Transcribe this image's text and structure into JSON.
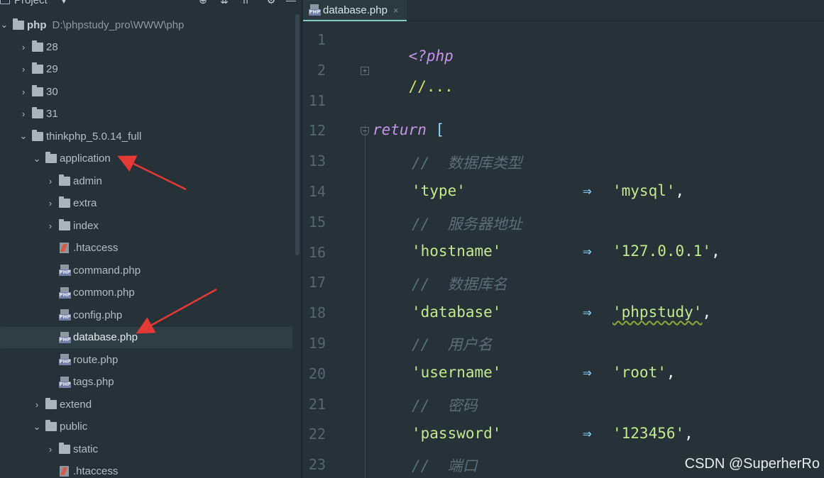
{
  "project_panel": {
    "title": "Project",
    "root": {
      "name": "php",
      "path": "D:\\phpstudy_pro\\WWW\\php"
    },
    "items": [
      {
        "label": "28",
        "type": "folder",
        "depth": 1,
        "expanded": false
      },
      {
        "label": "29",
        "type": "folder",
        "depth": 1,
        "expanded": false
      },
      {
        "label": "30",
        "type": "folder",
        "depth": 1,
        "expanded": false
      },
      {
        "label": "31",
        "type": "folder",
        "depth": 1,
        "expanded": false
      },
      {
        "label": "thinkphp_5.0.14_full",
        "type": "folder",
        "depth": 1,
        "expanded": true
      },
      {
        "label": "application",
        "type": "folder",
        "depth": 2,
        "expanded": true
      },
      {
        "label": "admin",
        "type": "folder",
        "depth": 3,
        "expanded": false
      },
      {
        "label": "extra",
        "type": "folder",
        "depth": 3,
        "expanded": false
      },
      {
        "label": "index",
        "type": "folder",
        "depth": 3,
        "expanded": false
      },
      {
        "label": ".htaccess",
        "type": "htaccess",
        "depth": 3
      },
      {
        "label": "command.php",
        "type": "php",
        "depth": 3
      },
      {
        "label": "common.php",
        "type": "php",
        "depth": 3
      },
      {
        "label": "config.php",
        "type": "php",
        "depth": 3
      },
      {
        "label": "database.php",
        "type": "php",
        "depth": 3,
        "selected": true
      },
      {
        "label": "route.php",
        "type": "php",
        "depth": 3
      },
      {
        "label": "tags.php",
        "type": "php",
        "depth": 3
      },
      {
        "label": "extend",
        "type": "folder",
        "depth": 2,
        "expanded": false
      },
      {
        "label": "public",
        "type": "folder",
        "depth": 2,
        "expanded": true
      },
      {
        "label": "static",
        "type": "folder",
        "depth": 3,
        "expanded": false
      },
      {
        "label": ".htaccess",
        "type": "htaccess",
        "depth": 3
      }
    ]
  },
  "editor": {
    "tab": {
      "label": "database.php",
      "close": "×"
    },
    "php_icon_text": "PHP",
    "line_numbers": [
      "1",
      "2",
      "11",
      "12",
      "13",
      "14",
      "15",
      "16",
      "17",
      "18",
      "19",
      "20",
      "21",
      "22",
      "23"
    ],
    "code": {
      "open_tag": "<?php",
      "folded": "//...",
      "return_kw": "return",
      "open_bracket": "[",
      "arrow": "⇒",
      "comment_type": "//  数据库类型",
      "key_type": "'type'",
      "val_type": "'mysql'",
      "comment_hostname": "//  服务器地址",
      "key_hostname": "'hostname'",
      "val_hostname": "'127.0.0.1'",
      "comment_database": "//  数据库名",
      "key_database": "'database'",
      "val_database": "'phpstudy'",
      "comment_username": "//  用户名",
      "key_username": "'username'",
      "val_username": "'root'",
      "comment_password": "//  密码",
      "key_password": "'password'",
      "val_password": "'123456'",
      "comment_port": "//  端口",
      "comma": ","
    }
  },
  "watermark": "CSDN @SuperherRo",
  "colors": {
    "background": "#263238",
    "keyword": "#c792ea",
    "string": "#c3e88d",
    "operator": "#89ddff",
    "comment": "#5b6e78",
    "annotation_arrow": "#e53935"
  }
}
